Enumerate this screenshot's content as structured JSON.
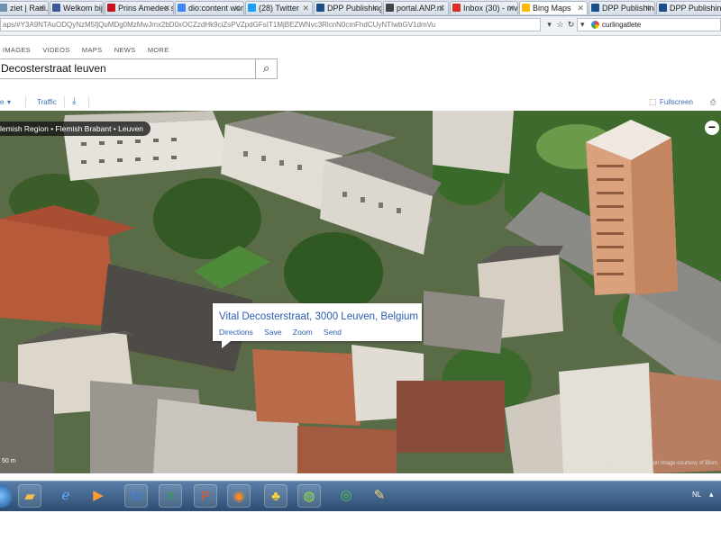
{
  "tabs": [
    {
      "label": "ziet | Radi...",
      "icon": "radio-icon",
      "color": "#6f8fb3"
    },
    {
      "label": "Welkom bij Fac...",
      "icon": "facebook-icon",
      "color": "#3b5998"
    },
    {
      "label": "Prins Amedeo st...",
      "icon": "news-icon",
      "color": "#c4161c"
    },
    {
      "label": "dio:content work",
      "icon": "google-icon",
      "color": "#4285f4"
    },
    {
      "label": "(28) Twitter",
      "icon": "twitter-icon",
      "color": "#1da1f2"
    },
    {
      "label": "DPP Publishing ...",
      "icon": "dpp-icon",
      "color": "#1b4f8a"
    },
    {
      "label": "portal.ANP.nl",
      "icon": "anp-icon",
      "color": "#444444"
    },
    {
      "label": "Inbox (30) - mv...",
      "icon": "gmail-icon",
      "color": "#d93025"
    },
    {
      "label": "Bing Maps",
      "icon": "bing-icon",
      "color": "#ffb900",
      "active": true
    },
    {
      "label": "DPP Publishing ...",
      "icon": "dpp-icon",
      "color": "#1b4f8a"
    },
    {
      "label": "DPP Publishing ...",
      "icon": "dpp-icon",
      "color": "#1b4f8a"
    }
  ],
  "address": {
    "url": "aps/#Y3A9NTAuODQyNzM5fjQuMDg0MzMwJmx2bD0xOCZzdHk9ciZsPVZpdGFsIT1MjBEZWNvc3RlcnN0cmFhdCUyNTIwbGV1dmVu",
    "search_value": "curlingatlete"
  },
  "nav": {
    "images": "IMAGES",
    "videos": "VIDEOS",
    "maps": "MAPS",
    "news": "NEWS",
    "more": "MORE"
  },
  "search": {
    "query": "Decosterstraat leuven"
  },
  "maptools": {
    "view": "e",
    "traffic": "Traffic",
    "fullscreen": "Fullscreen"
  },
  "map": {
    "breadcrumb": "lemish Region • Flemish Brabant • Leuven",
    "infobox": {
      "title": "Vital Decosterstraat, 3000 Leuven, Belgium",
      "actions": [
        "Directions",
        "Save",
        "Zoom",
        "Send"
      ]
    },
    "scale": "50 m",
    "copyright": "© 2012 Microsoft Corporation  Image courtesy of Blom"
  },
  "taskbar": {
    "items": [
      "folder-icon",
      "ie-icon",
      "media-player-icon",
      "word-icon",
      "excel-icon",
      "powerpoint-icon",
      "firefox-icon",
      "pin-icon",
      "messenger-icon",
      "spotify-icon",
      "paint-icon"
    ],
    "language": "NL"
  }
}
